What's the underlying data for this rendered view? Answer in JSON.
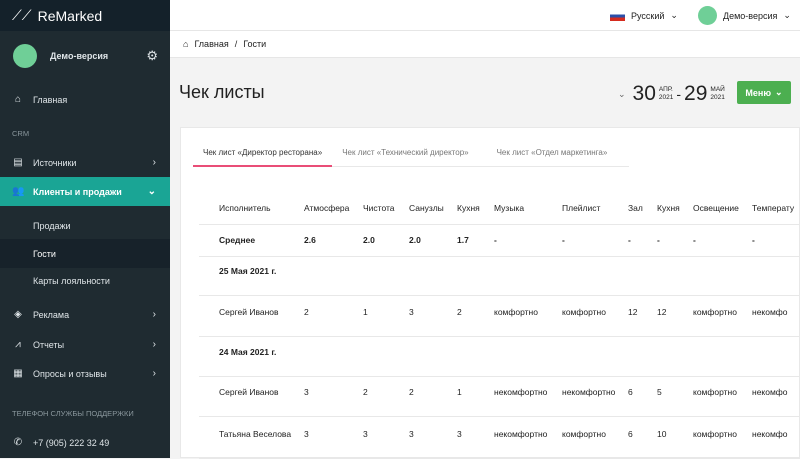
{
  "app": {
    "logo": "ReMarked",
    "user": "Демо-версия"
  },
  "sidebar": {
    "home": "Главная",
    "crm_label": "CRM",
    "items": [
      {
        "label": "Источники"
      },
      {
        "label": "Клиенты и продажи"
      },
      {
        "label": "Продажи"
      },
      {
        "label": "Гости"
      },
      {
        "label": "Карты лояльности"
      },
      {
        "label": "Реклама"
      },
      {
        "label": "Отчеты"
      },
      {
        "label": "Опросы и отзывы"
      }
    ],
    "support_label": "ТЕЛЕФОН СЛУЖБЫ ПОДДЕРЖКИ",
    "phone": "+7 (905) 222 32 49"
  },
  "header": {
    "language": "Русский",
    "user": "Демо-версия"
  },
  "breadcrumb": [
    "Главная",
    "/",
    "Гости"
  ],
  "page": {
    "title": "Чек листы",
    "date_from_day": "30",
    "date_from_month": "АПР.",
    "date_from_year": "2021",
    "date_sep": "-",
    "date_to_day": "29",
    "date_to_month": "МАЙ",
    "date_to_year": "2021",
    "menu_button": "Меню"
  },
  "tabs": [
    "Чек лист «Директор ресторана»",
    "Чек лист «Технический директор»",
    "Чек лист «Отдел маркетинга»"
  ],
  "table": {
    "headers": [
      "Исполнитель",
      "Атмосфера",
      "Чистота",
      "Санузлы",
      "Кухня",
      "Музыка",
      "Плейлист",
      "Зал",
      "Кухня",
      "Освещение",
      "Температу"
    ],
    "rows": [
      {
        "type": "avg",
        "cells": [
          "Среднее",
          "2.6",
          "2.0",
          "2.0",
          "1.7",
          "-",
          "-",
          "-",
          "-",
          "-",
          "-"
        ]
      },
      {
        "type": "date",
        "cells": [
          "25 Мая 2021 г."
        ]
      },
      {
        "type": "data",
        "cells": [
          "Сергей Иванов",
          "2",
          "1",
          "3",
          "2",
          "комфортно",
          "комфортно",
          "12",
          "12",
          "комфортно",
          "некомфо"
        ]
      },
      {
        "type": "date",
        "cells": [
          "24 Мая 2021 г."
        ]
      },
      {
        "type": "data",
        "cells": [
          "Сергей Иванов",
          "3",
          "2",
          "2",
          "1",
          "некомфортно",
          "некомфортно",
          "6",
          "5",
          "комфортно",
          "некомфо"
        ]
      },
      {
        "type": "data",
        "cells": [
          "Татьяна Веселова",
          "3",
          "3",
          "3",
          "3",
          "некомфортно",
          "комфортно",
          "6",
          "10",
          "комфортно",
          "некомфо"
        ]
      }
    ]
  },
  "colors": {
    "sidebar": "#1f2b31",
    "active": "#1aa595",
    "accent_tab": "#e94d77",
    "button": "#4caf50"
  }
}
